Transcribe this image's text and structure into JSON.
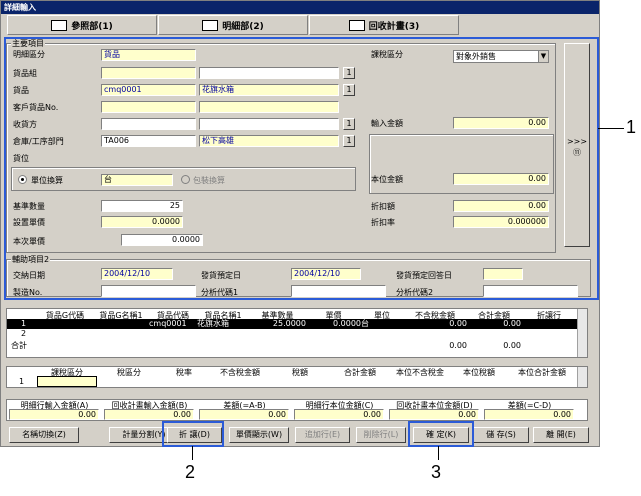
{
  "window": {
    "title": "詳細輸入"
  },
  "tabs": [
    {
      "label": "參照部(1)"
    },
    {
      "label": "明細部(2)"
    },
    {
      "label": "回收計畫(3)"
    }
  ],
  "main_group": {
    "title": "主要項目",
    "detail_type": {
      "label": "明細區分",
      "value": "貨品"
    },
    "product_group": {
      "label": "貨品組"
    },
    "product": {
      "label": "貨品",
      "code": "cmq0001",
      "name": "花旗水箱"
    },
    "customer_product_no": {
      "label": "客戶貨品No."
    },
    "receiver": {
      "label": "收貨方"
    },
    "warehouse": {
      "label": "倉庫/工序部門",
      "code": "TA006",
      "name": "松下高雄"
    },
    "location": {
      "label": "貨位"
    },
    "unit_conv": {
      "label": "單位換算",
      "value": "台"
    },
    "pack_conv": {
      "label": "包裝換算"
    },
    "base_qty": {
      "label": "基準數量",
      "value": "25"
    },
    "std_price": {
      "label": "設置單價",
      "value": "0.0000"
    },
    "this_price": {
      "label": "本次單價",
      "value": "0.0000"
    },
    "tax_type": {
      "label": "課稅區分",
      "value": "對象外銷售"
    },
    "input_amount": {
      "label": "輸入金額",
      "value": "0.00"
    },
    "local_amount": {
      "label": "本位金額",
      "value": "0.00"
    },
    "discount": {
      "label": "折扣額",
      "value": "0.00"
    },
    "discount_rate": {
      "label": "折扣率",
      "value": "0.000000"
    },
    "btn_one": "1"
  },
  "side_button": {
    "label": ">>>\n⑪"
  },
  "aux_group": {
    "title": "輔助項目2",
    "trade_date": {
      "label": "交納日期",
      "value": "2004/12/10"
    },
    "planned_ship": {
      "label": "發貨預定日",
      "value": "2004/12/10"
    },
    "planned_reply": {
      "label": "發貨預定回答日"
    },
    "mfg_no": {
      "label": "製造No."
    },
    "analysis1": {
      "label": "分析代碼1"
    },
    "analysis2": {
      "label": "分析代碼2"
    }
  },
  "grid1": {
    "headers": [
      "貨品G代碼",
      "貨品G名稱1",
      "貨品代碼",
      "貨品名稱1",
      "基準數量",
      "單價",
      "單位",
      "不含稅金額",
      "合計金額",
      "折讓行"
    ],
    "rows": [
      {
        "no": "1",
        "cells": [
          "",
          "",
          "cmq0001",
          "花旗水箱",
          "25.0000",
          "0.0000",
          "台",
          "0.00",
          "0.00",
          ""
        ]
      },
      {
        "no": "2",
        "cells": [
          "",
          "",
          "",
          "",
          "",
          "",
          "",
          "",
          "",
          ""
        ]
      }
    ],
    "total_label": "合計",
    "totals": [
      "0.00",
      "0.00"
    ]
  },
  "grid2": {
    "headers": [
      "課稅區分",
      "稅區分",
      "稅率",
      "不含稅金額",
      "稅額",
      "合計金額",
      "本位不含稅金",
      "本位稅額",
      "本位合計金額"
    ],
    "rows": [
      {
        "no": "1"
      }
    ]
  },
  "summary": {
    "headers": [
      "明細行輸入金額(A)",
      "回收計畫輸入金額(B)",
      "差額(=A-B)",
      "明細行本位金額(C)",
      "回收計畫本位金額(D)",
      "差額(=C-D)"
    ],
    "values": [
      "0.00",
      "0.00",
      "0.00",
      "0.00",
      "0.00",
      "0.00"
    ]
  },
  "buttons": {
    "name_switch": "名稱切換(Z)",
    "plan_split": "計量分割(Y)",
    "discount": "折 讓(D)",
    "unit_price_display": "單價顯示(W)",
    "add_row": "追加行(E)",
    "delete_row": "削除行(L)",
    "confirm": "確 定(K)",
    "save": "儲 存(S)",
    "close": "離 開(E)"
  },
  "callouts": [
    "1",
    "2",
    "3"
  ],
  "colors": {
    "highlight": "#2b5bd7",
    "titlebar": "#0a246a",
    "input_yellow": "#ffffcc"
  }
}
